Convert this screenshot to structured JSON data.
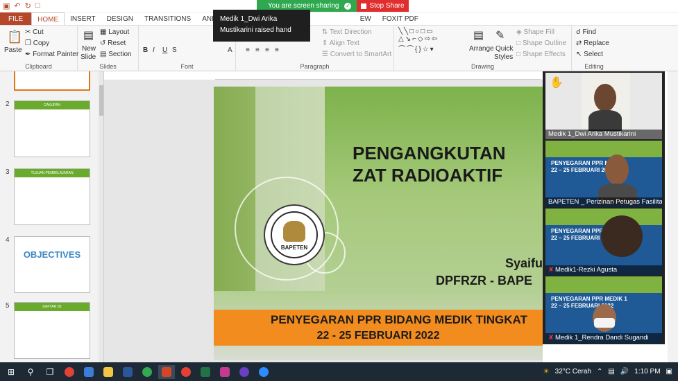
{
  "share": {
    "status": "You are screen sharing",
    "stop_label": "Stop Share"
  },
  "tooltip": {
    "line1": "Medik 1_Dwi Arika",
    "line2": "Mustikarini raised hand"
  },
  "tabs": [
    "FILE",
    "HOME",
    "INSERT",
    "DESIGN",
    "TRANSITIONS",
    "ANIMATIONS",
    "EW",
    "FOXIT PDF"
  ],
  "ribbon": {
    "clipboard": {
      "paste": "Paste",
      "cut": "Cut",
      "copy": "Copy",
      "format_painter": "Format Painter",
      "label": "Clipboard"
    },
    "slides": {
      "new_slide": "New",
      "new_slide2": "Slide",
      "layout": "Layout",
      "reset": "Reset",
      "section": "Section",
      "label": "Slides"
    },
    "font": {
      "label": "Font"
    },
    "paragraph": {
      "text_direction": "Text Direction",
      "align_text": "Align Text",
      "smartart": "Convert to SmartArt",
      "label": "Paragraph"
    },
    "drawing": {
      "arrange": "Arrange",
      "quick": "Quick",
      "styles": "Styles",
      "shape_fill": "Shape Fill",
      "shape_outline": "Shape Outline",
      "shape_effects": "Shape Effects",
      "label": "Drawing"
    },
    "editing": {
      "find": "Find",
      "replace": "Replace",
      "select": "Select",
      "label": "Editing"
    }
  },
  "thumbnails": [
    {
      "num": "2",
      "title": "CAKUPAN"
    },
    {
      "num": "3",
      "title": "TUJUAN PEMBELAJARAN"
    },
    {
      "num": "4",
      "title": "OBJECTIVES"
    },
    {
      "num": "5",
      "title": "DAFTAR ISI"
    }
  ],
  "slide": {
    "title1": "PENGANGKUTAN",
    "title2": "ZAT RADIOAKTIF",
    "author": "Syaifu",
    "org": "DPFRZR - BAPE",
    "logo_text": "BAPETEN",
    "bottom1": "PENYEGARAN PPR BIDANG MEDIK TINGKAT",
    "bottom2": "22 - 25 FEBRUARI 2022"
  },
  "participants": [
    {
      "name": "Medik 1_Dwi Arika Mustikarini",
      "hand": "✋"
    },
    {
      "name": "BAPETEN _ Perizinan Petugas Fasilita...",
      "banner1": "PENYEGARAN PPR M",
      "banner2": "22 – 25 FEBRUARI 20"
    },
    {
      "name": "Medik1-Rezki Agusta",
      "banner1": "PENYEGARAN PPR MEDIK",
      "banner2": "22 – 25 FEBRUARI 2022"
    },
    {
      "name": "Medik 1_Rendra Dandi Sugandi",
      "banner1": "PENYEGARAN PPR MEDIK 1",
      "banner2": "22 – 25 FEBRUARI 2022"
    }
  ],
  "taskbar": {
    "weather": "32°C  Cerah",
    "time": "1:10 PM"
  }
}
